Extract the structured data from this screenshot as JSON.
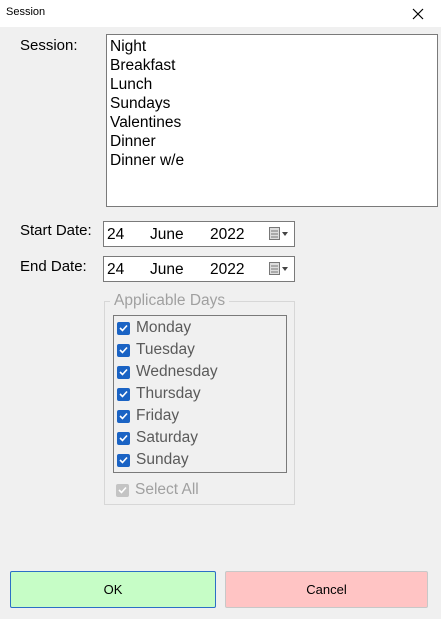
{
  "window": {
    "title": "Session",
    "close_icon": "close-icon"
  },
  "session": {
    "label": "Session:",
    "items": [
      "Night",
      "Breakfast",
      "Lunch",
      "Sundays",
      "Valentines",
      "Dinner",
      "Dinner w/e"
    ]
  },
  "start_date": {
    "label": "Start Date:",
    "day": "24",
    "month": "June",
    "year": "2022",
    "icon": "calendar-dropdown-icon"
  },
  "end_date": {
    "label": "End Date:",
    "day": "24",
    "month": "June",
    "year": "2022",
    "icon": "calendar-dropdown-icon"
  },
  "applicable_days": {
    "legend": "Applicable Days",
    "days": [
      {
        "label": "Monday",
        "checked": true
      },
      {
        "label": "Tuesday",
        "checked": true
      },
      {
        "label": "Wednesday",
        "checked": true
      },
      {
        "label": "Thursday",
        "checked": true
      },
      {
        "label": "Friday",
        "checked": true
      },
      {
        "label": "Saturday",
        "checked": true
      },
      {
        "label": "Sunday",
        "checked": true
      }
    ],
    "select_all": {
      "label": "Select All",
      "checked": true,
      "enabled": false
    }
  },
  "buttons": {
    "ok": "OK",
    "cancel": "Cancel"
  },
  "colors": {
    "ok_bg": "#c6fdc6",
    "cancel_bg": "#ffc4c4",
    "checkbox": "#1a63c4"
  }
}
